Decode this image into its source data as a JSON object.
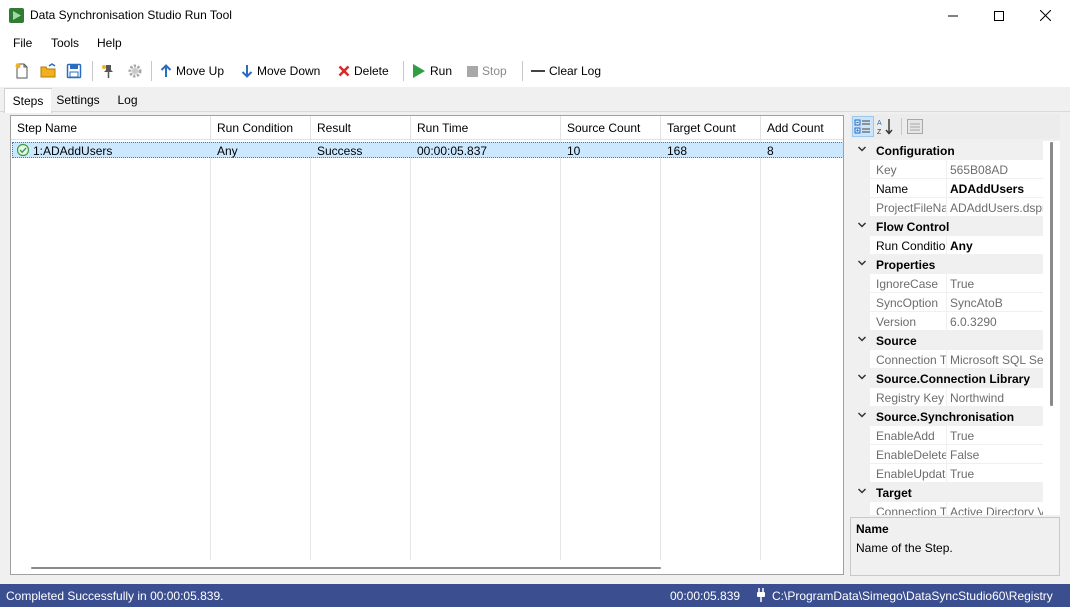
{
  "window": {
    "title": "Data Synchronisation Studio Run Tool",
    "controls": {
      "minimize": "minimize",
      "maximize": "maximize",
      "close": "close"
    }
  },
  "menu": [
    "File",
    "Tools",
    "Help"
  ],
  "toolbar": {
    "icons": [
      "new-file-icon",
      "open-folder-icon",
      "save-icon",
      "pin-icon",
      "gear-icon"
    ],
    "move_up": "Move Up",
    "move_down": "Move Down",
    "delete": "Delete",
    "run": "Run",
    "stop": "Stop",
    "clear_log": "Clear Log"
  },
  "tabs": [
    "Steps",
    "Settings",
    "Log"
  ],
  "grid": {
    "columns": [
      "Step Name",
      "Run Condition",
      "Result",
      "Run Time",
      "Source Count",
      "Target Count",
      "Add Count"
    ],
    "rows": [
      {
        "step_name": "1:ADAddUsers",
        "run_condition": "Any",
        "result": "Success",
        "run_time": "00:00:05.837",
        "source_count": "10",
        "target_count": "168",
        "add_count": "8"
      }
    ]
  },
  "properties": {
    "rows": [
      {
        "kind": "cat",
        "label": "Configuration"
      },
      {
        "kind": "prop",
        "name": "Key",
        "value": "565B08AD",
        "bold": false
      },
      {
        "kind": "prop",
        "name": "Name",
        "value": "ADAddUsers",
        "bold": true
      },
      {
        "kind": "prop",
        "name": "ProjectFileNa",
        "value": "ADAddUsers.dspr",
        "bold": false
      },
      {
        "kind": "cat",
        "label": "Flow Control"
      },
      {
        "kind": "prop",
        "name": "Run Conditio",
        "value": "Any",
        "bold": true
      },
      {
        "kind": "cat",
        "label": "Properties"
      },
      {
        "kind": "prop",
        "name": "IgnoreCase",
        "value": "True",
        "bold": false
      },
      {
        "kind": "prop",
        "name": "SyncOption",
        "value": "SyncAtoB",
        "bold": false
      },
      {
        "kind": "prop",
        "name": "Version",
        "value": "6.0.3290",
        "bold": false
      },
      {
        "kind": "cat",
        "label": "Source"
      },
      {
        "kind": "prop",
        "name": "Connection T",
        "value": "Microsoft SQL Ser",
        "bold": false
      },
      {
        "kind": "cat",
        "label": "Source.Connection Library"
      },
      {
        "kind": "prop",
        "name": "Registry Key",
        "value": "Northwind",
        "bold": false
      },
      {
        "kind": "cat",
        "label": "Source.Synchronisation"
      },
      {
        "kind": "prop",
        "name": "EnableAdd",
        "value": "True",
        "bold": false
      },
      {
        "kind": "prop",
        "name": "EnableDelete",
        "value": "False",
        "bold": false
      },
      {
        "kind": "prop",
        "name": "EnableUpdate",
        "value": "True",
        "bold": false
      },
      {
        "kind": "cat",
        "label": "Target"
      },
      {
        "kind": "prop",
        "name": "Connection T",
        "value": "Active Directory V",
        "bold": false
      }
    ],
    "description": {
      "title": "Name",
      "text": "Name of the Step."
    }
  },
  "status": {
    "message": "Completed Successfully in 00:00:05.839.",
    "elapsed": "00:00:05.839",
    "path": "C:\\ProgramData\\Simego\\DataSyncStudio60\\Registry"
  },
  "colors": {
    "status_bar": "#3b4e8f",
    "selected_row": "#cce8ff",
    "run_green": "#2ea043",
    "delete_red": "#d62b2b",
    "arrow_blue": "#2a6cc0"
  }
}
